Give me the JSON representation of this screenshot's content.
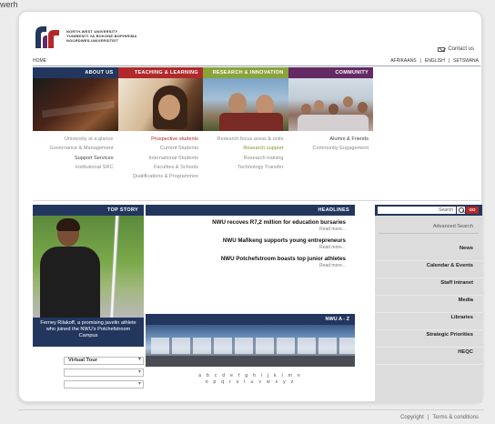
{
  "fragment_top": "werh",
  "header": {
    "logo_lines": [
      "NORTH-WEST UNIVERSITY",
      "YUNIBESITI YA BOKONE-BOPHIRIMA",
      "NOORDWES-UNIVERSITEIT"
    ],
    "contact_label": "Contact us",
    "home_link": "HOME",
    "languages": [
      "AFRIKAANS",
      "ENGLISH",
      "SETSWANA"
    ],
    "lang_separator": "|"
  },
  "faculties": [
    {
      "label": "ABOUT US",
      "color": "#22365e"
    },
    {
      "label": "TEACHING & LEARNING",
      "color": "#b1292a"
    },
    {
      "label": "RESEARCH & INNOVATION",
      "color": "#8aa33a"
    },
    {
      "label": "COMMUNITY",
      "color": "#632a63"
    }
  ],
  "links": {
    "about": [
      "University at a glance",
      "Governance & Management",
      "Support Services",
      "Institutional SRC"
    ],
    "teaching": [
      "Prospective students",
      "Current Students",
      "International Students",
      "Faculties & Schools",
      "Qualifications & Programmes"
    ],
    "research": [
      "Research focus areas & units",
      "Research support",
      "Research training",
      "Technology Transfer"
    ],
    "community": [
      "Alumni & Friends",
      "Community Engagement"
    ]
  },
  "top_story": {
    "bar_label": "TOP STORY",
    "caption": "Ferney Rilakoff, a promising javelin athlete who joined the NWU's Potchefstroom Campus"
  },
  "headlines": {
    "bar_label": "HEADLINES",
    "items": [
      {
        "title": "NWU recoves R7,2 million for education bursaries",
        "more": "Read more..."
      },
      {
        "title": "NWU Mafikeng supports young entrepreneurs",
        "more": "Read more..."
      },
      {
        "title": "NWU Potchefstroom boasts top junior athletes",
        "more": "Read more..."
      }
    ]
  },
  "nwu_az": {
    "bar_label": "NWU A - Z",
    "row1": "a b c d e f g h i j k l m n",
    "row2": "o p q r s t u v w x y z"
  },
  "virtual_tour": {
    "label": "Virtual Tour"
  },
  "search": {
    "placeholder": "Search",
    "go_label": "GO",
    "advanced": "Advanced Search"
  },
  "side_menu": [
    "News",
    "Calendar & Events",
    "Staff intranet",
    "Media",
    "Libraries",
    "Strategic Priorities",
    "HEQC"
  ],
  "footer": {
    "links": [
      "Copyright",
      "Terms & conditions"
    ],
    "separator": "|"
  }
}
